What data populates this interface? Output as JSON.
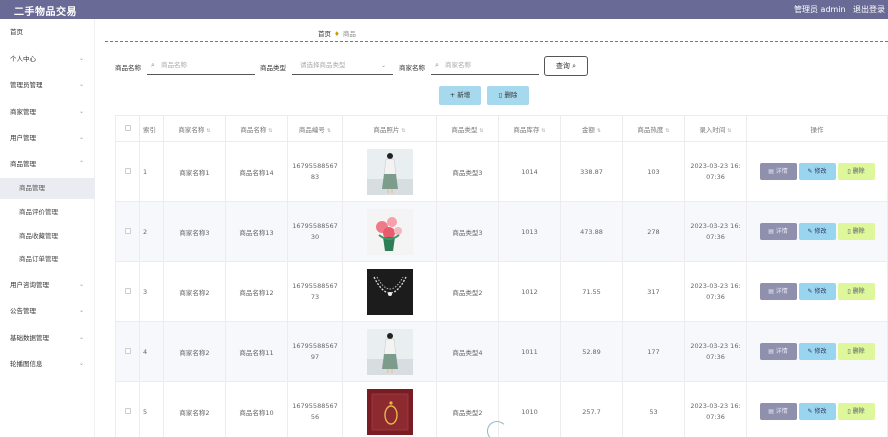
{
  "header": {
    "title": "二手物品交易",
    "user": "管理员 admin",
    "logout": "退出登录"
  },
  "sidebar": {
    "items": [
      {
        "label": "首页",
        "chevron": ""
      },
      {
        "label": "个人中心",
        "chevron": "⌄"
      },
      {
        "label": "管理员管理",
        "chevron": "⌄"
      },
      {
        "label": "商家管理",
        "chevron": "⌄"
      },
      {
        "label": "用户管理",
        "chevron": "⌄"
      },
      {
        "label": "商品管理",
        "chevron": "⌃"
      },
      {
        "label": "用户咨询管理",
        "chevron": "⌄"
      },
      {
        "label": "公告管理",
        "chevron": "⌄"
      },
      {
        "label": "基础数据管理",
        "chevron": "⌄"
      },
      {
        "label": "轮播图信息",
        "chevron": "⌄"
      }
    ],
    "sub_items": [
      {
        "label": "商品管理",
        "active": true
      },
      {
        "label": "商品评价管理",
        "active": false
      },
      {
        "label": "商品收藏管理",
        "active": false
      },
      {
        "label": "商品订单管理",
        "active": false
      }
    ]
  },
  "breadcrumb": {
    "home": "首页",
    "current": "商品"
  },
  "search": {
    "name_label": "商品名称",
    "name_placeholder": "商品名称",
    "type_label": "商品类型",
    "type_placeholder": "请选择商品类型",
    "merchant_label": "商家名称",
    "merchant_placeholder": "商家名称",
    "query_button": "查询"
  },
  "actions": {
    "add": "新增",
    "delete": "删除"
  },
  "table": {
    "headers": [
      "索引",
      "商家名称",
      "商品名称",
      "商品编号",
      "商品照片",
      "商品类型",
      "商品库存",
      "金额",
      "商品热度",
      "录入时间",
      "操作"
    ],
    "ops": {
      "detail": "详情",
      "edit": "修改",
      "remove": "删除"
    },
    "rows": [
      {
        "index": "1",
        "merchant": "商家名称1",
        "name": "商品名称14",
        "code": "1679558856783",
        "photo": "dress-photo",
        "type": "商品类型3",
        "stock": "1014",
        "amount": "338.87",
        "heat": "103",
        "time": "2023-03-23 16:07:36"
      },
      {
        "index": "2",
        "merchant": "商家名称3",
        "name": "商品名称13",
        "code": "1679558856730",
        "photo": "flowers-photo",
        "type": "商品类型3",
        "stock": "1013",
        "amount": "473.88",
        "heat": "278",
        "time": "2023-03-23 16:07:36"
      },
      {
        "index": "3",
        "merchant": "商家名称2",
        "name": "商品名称12",
        "code": "1679558856773",
        "photo": "necklace-photo",
        "type": "商品类型2",
        "stock": "1012",
        "amount": "71.55",
        "heat": "317",
        "time": "2023-03-23 16:07:36"
      },
      {
        "index": "4",
        "merchant": "商家名称2",
        "name": "商品名称11",
        "code": "1679558856797",
        "photo": "dress-photo",
        "type": "商品类型4",
        "stock": "1011",
        "amount": "52.89",
        "heat": "177",
        "time": "2023-03-23 16:07:36"
      },
      {
        "index": "5",
        "merchant": "商家名称2",
        "name": "商品名称10",
        "code": "1679558856756",
        "photo": "earring-photo",
        "type": "商品类型2",
        "stock": "1010",
        "amount": "257.7",
        "heat": "53",
        "time": "2023-03-23 16:07:36"
      }
    ]
  },
  "colors": {
    "header_bg": "#6a6a96",
    "detail_btn": "#8f8fae",
    "edit_btn": "#9ad5f0",
    "remove_btn": "#ddf79a",
    "action_btn": "#a6d8ee"
  }
}
